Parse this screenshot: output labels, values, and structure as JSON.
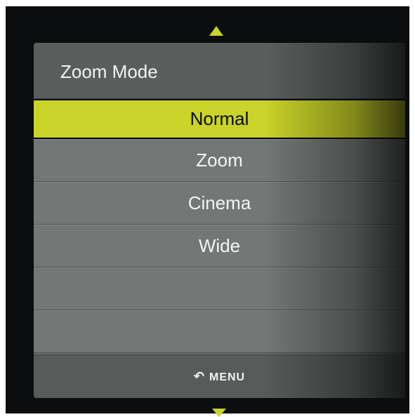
{
  "menu": {
    "title": "Zoom Mode",
    "items": [
      {
        "label": "Normal",
        "selected": true
      },
      {
        "label": "Zoom",
        "selected": false
      },
      {
        "label": "Cinema",
        "selected": false
      },
      {
        "label": "Wide",
        "selected": false
      },
      {
        "label": "",
        "selected": false
      },
      {
        "label": "",
        "selected": false
      }
    ],
    "footer": {
      "icon": "back-arrow-icon",
      "label": "MENU"
    }
  },
  "colors": {
    "accent": "#c9d32a",
    "panel": "#737876",
    "background": "#0b0d0e"
  }
}
